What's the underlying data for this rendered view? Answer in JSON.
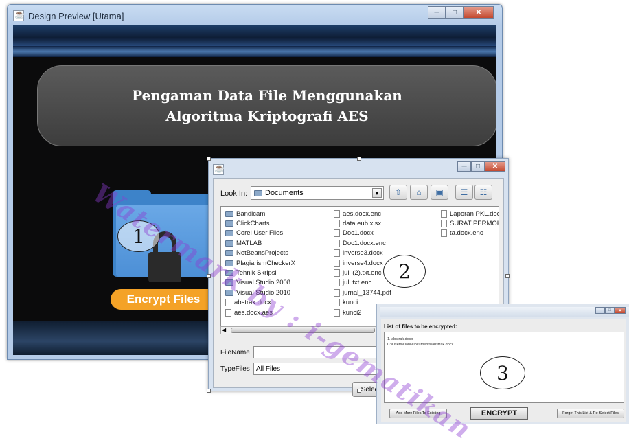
{
  "main_window": {
    "title": "Design Preview [Utama]",
    "banner_title": "Pengaman Data File Menggunakan\nAlgoritma Kriptografi AES",
    "encrypt_files_label": "Encrypt Files"
  },
  "callouts": [
    "1",
    "2",
    "3"
  ],
  "file_chooser": {
    "look_in_label": "Look In:",
    "look_in_value": "Documents",
    "columns": [
      [
        {
          "name": "Bandicam",
          "type": "folder"
        },
        {
          "name": "ClickCharts",
          "type": "folder"
        },
        {
          "name": "Corel User Files",
          "type": "folder"
        },
        {
          "name": "MATLAB",
          "type": "folder"
        },
        {
          "name": "NetBeansProjects",
          "type": "folder"
        },
        {
          "name": "PlagiarismCheckerX",
          "type": "folder"
        },
        {
          "name": "Tehnik Skripsi",
          "type": "folder"
        },
        {
          "name": "Visual Studio 2008",
          "type": "folder"
        },
        {
          "name": "Visual Studio 2010",
          "type": "folder"
        },
        {
          "name": "abstrak.docx",
          "type": "file"
        },
        {
          "name": "aes.docx.aes",
          "type": "file"
        }
      ],
      [
        {
          "name": "aes.docx.enc",
          "type": "file"
        },
        {
          "name": "data eub.xlsx",
          "type": "file"
        },
        {
          "name": "Doc1.docx",
          "type": "file"
        },
        {
          "name": "Doc1.docx.enc",
          "type": "file"
        },
        {
          "name": "inverse3.docx",
          "type": "file"
        },
        {
          "name": "inverse4.docx",
          "type": "file"
        },
        {
          "name": "juli (2).txt.enc",
          "type": "file"
        },
        {
          "name": "juli.txt.enc",
          "type": "file"
        },
        {
          "name": "jurnal_13744.pdf",
          "type": "file"
        },
        {
          "name": "kunci",
          "type": "file"
        },
        {
          "name": "kunci2",
          "type": "file"
        }
      ],
      [
        {
          "name": "Laporan PKL.docx",
          "type": "file"
        },
        {
          "name": "SURAT PERMOHO",
          "type": "file"
        },
        {
          "name": "ta.docx.enc",
          "type": "file"
        }
      ]
    ],
    "file_name_label": "FileName",
    "file_types_label": "TypeFiles",
    "file_types_value": "All Files",
    "select_button_label": "Select F"
  },
  "encrypt_dialog": {
    "list_label": "List of files to be encrypted:",
    "list_lines": [
      "1. abstrak.docx",
      "C:\\Users\\Dani\\Documents\\abstrak.docx"
    ],
    "add_more_label": "Add More Files To Existing",
    "encrypt_label": "ENCRYPT",
    "forget_label": "Forget This List & Re-Select Files"
  },
  "watermark_text": "Watermark by : i-gematikan"
}
